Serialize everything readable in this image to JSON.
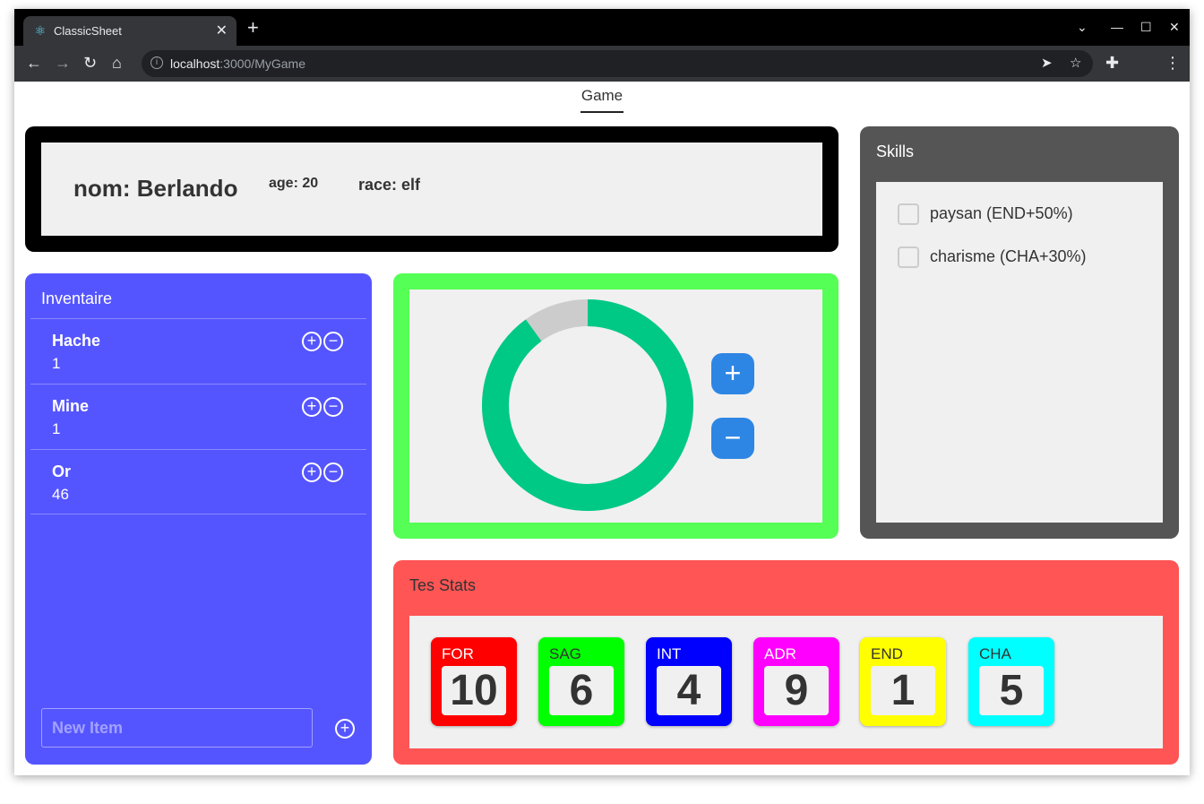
{
  "browser": {
    "tab_title": "ClassicSheet",
    "new_tab": "+",
    "url_host": "localhost",
    "url_rest": ":3000/MyGame"
  },
  "app": {
    "nav_tab": "Game"
  },
  "character": {
    "nom": "nom: Berlando",
    "age": "age: 20",
    "race": "race: elf"
  },
  "skills": {
    "title": "Skills",
    "items": [
      {
        "label": "paysan (END+50%)",
        "checked": false
      },
      {
        "label": "charisme (CHA+30%)",
        "checked": false
      }
    ]
  },
  "inventory": {
    "title": "Inventaire",
    "items": [
      {
        "name": "Hache",
        "qty": "1"
      },
      {
        "name": "Mine",
        "qty": "1"
      },
      {
        "name": "Or",
        "qty": "46"
      }
    ],
    "new_item_placeholder": "New Item"
  },
  "health": {
    "value_fraction": 0.9,
    "filled_color": "#00c986",
    "empty_color": "#cccccc"
  },
  "stats": {
    "title": "Tes Stats",
    "items": [
      {
        "label": "FOR",
        "value": "10",
        "color": "#ff0000",
        "label_color": "#ffffff"
      },
      {
        "label": "SAG",
        "value": "6",
        "color": "#00ff00",
        "label_color": "#333333"
      },
      {
        "label": "INT",
        "value": "4",
        "color": "#0000ff",
        "label_color": "#ffffff"
      },
      {
        "label": "ADR",
        "value": "9",
        "color": "#ff00ff",
        "label_color": "#ffffff"
      },
      {
        "label": "END",
        "value": "1",
        "color": "#ffff00",
        "label_color": "#333333"
      },
      {
        "label": "CHA",
        "value": "5",
        "color": "#00ffff",
        "label_color": "#333333"
      }
    ]
  }
}
